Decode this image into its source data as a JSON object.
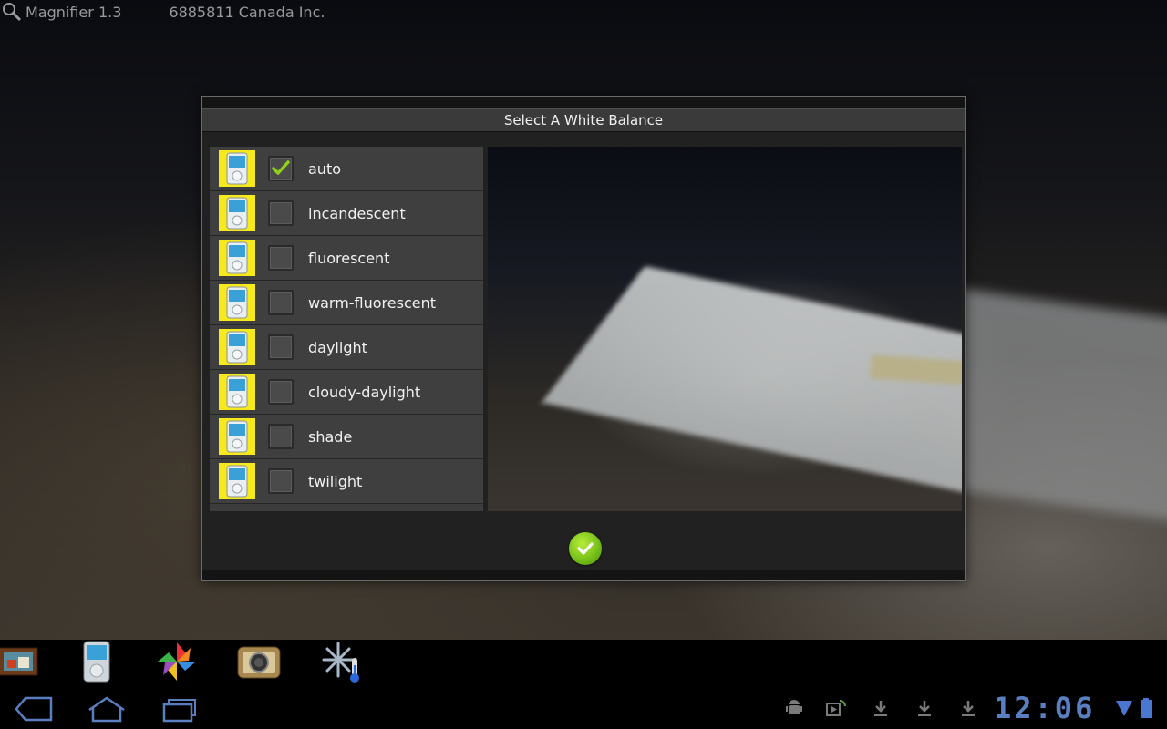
{
  "app": {
    "title": "Magnifier 1.3",
    "developer": "6885811 Canada Inc."
  },
  "dialog": {
    "title": "Select A White Balance",
    "options": [
      {
        "label": "auto",
        "checked": true
      },
      {
        "label": "incandescent",
        "checked": false
      },
      {
        "label": "fluorescent",
        "checked": false
      },
      {
        "label": "warm-fluorescent",
        "checked": false
      },
      {
        "label": "daylight",
        "checked": false
      },
      {
        "label": "cloudy-daylight",
        "checked": false
      },
      {
        "label": "shade",
        "checked": false
      },
      {
        "label": "twilight",
        "checked": false
      }
    ],
    "confirm_icon": "checkmark-icon"
  },
  "dock": {
    "apps": [
      "picture-frame-icon",
      "media-player-icon",
      "pinwheel-gallery-icon",
      "camera-icon",
      "snowflake-thermometer-icon"
    ]
  },
  "system_bar": {
    "clock": "12:06",
    "nav": [
      "back-icon",
      "home-icon",
      "recent-apps-icon"
    ],
    "status": [
      "android-debug-icon",
      "media-play-icon",
      "download-icon",
      "download-icon",
      "download-icon",
      "signal-icon",
      "battery-icon"
    ]
  },
  "colors": {
    "thumb_background": "#f6ea1c",
    "check_green": "#8fd01e",
    "clock_blue": "#5a7fc0"
  }
}
